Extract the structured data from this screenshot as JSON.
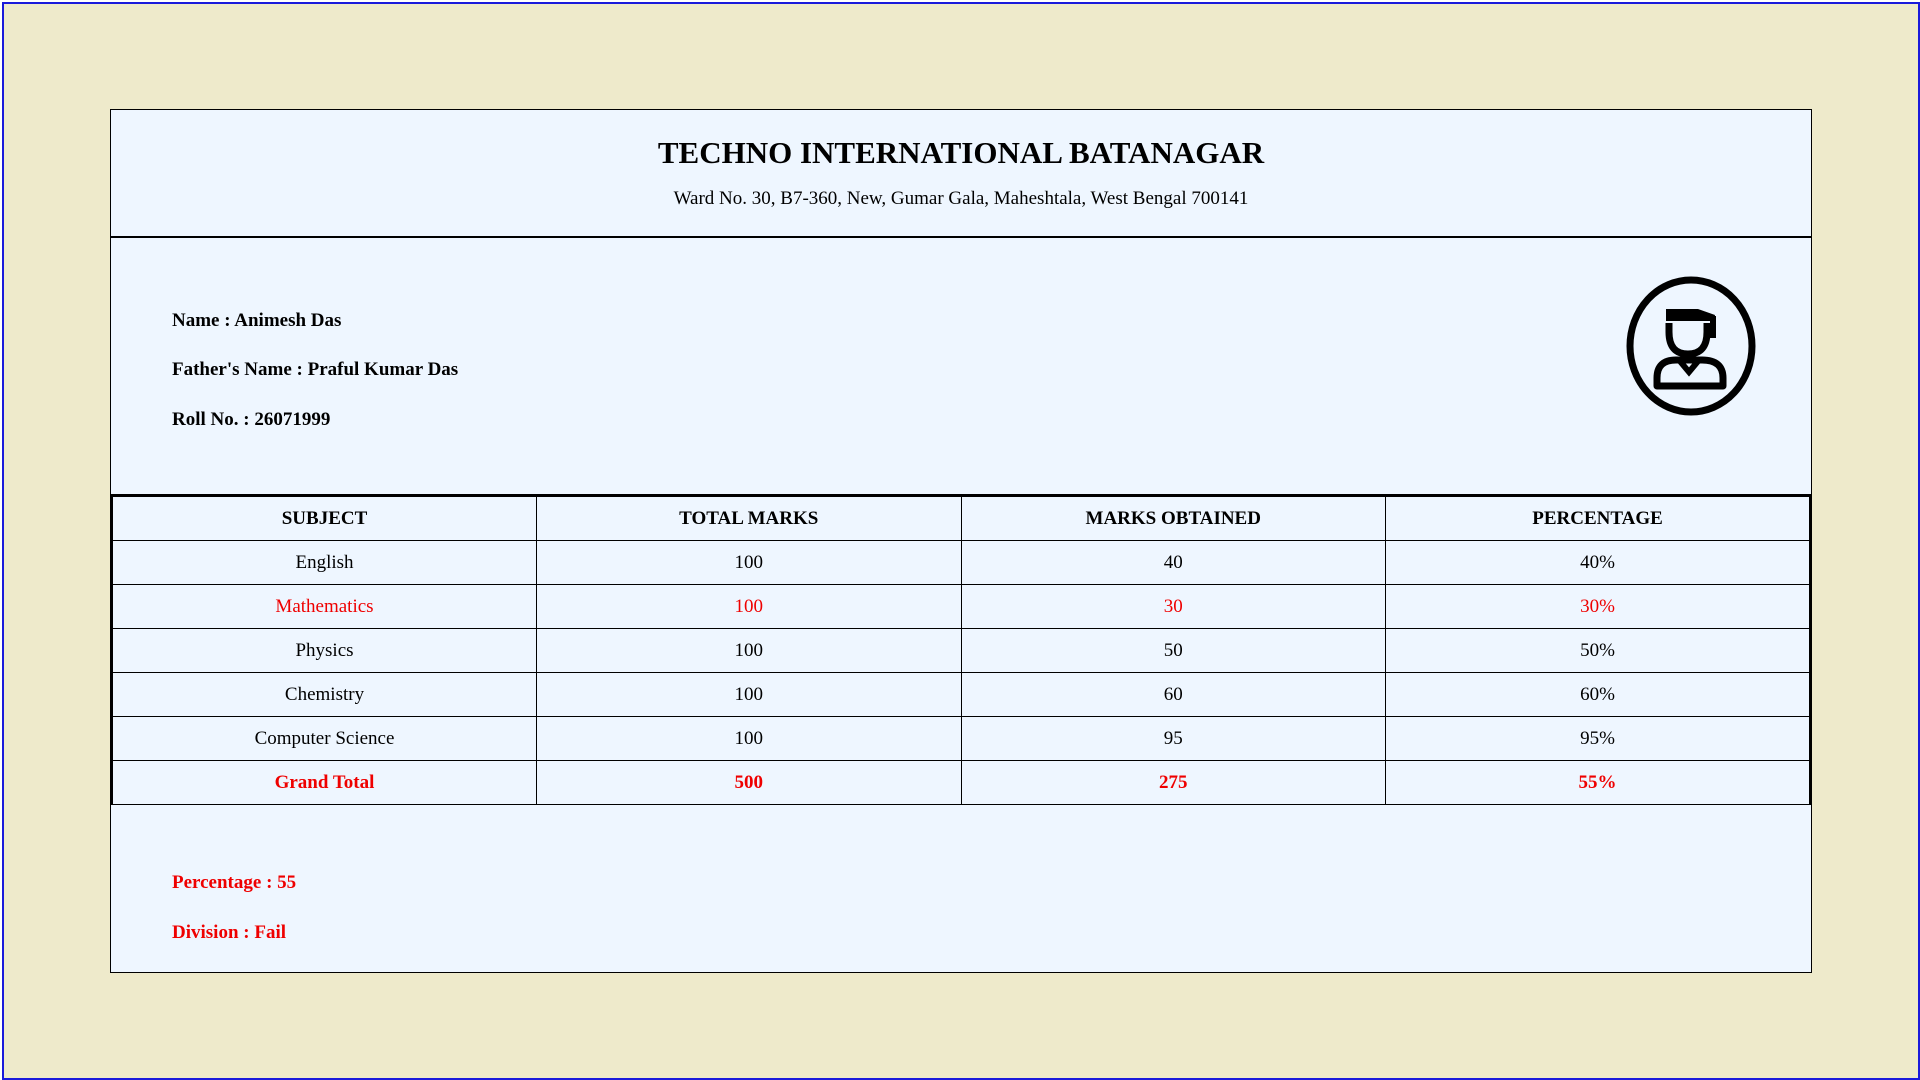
{
  "school": {
    "name": "TECHNO INTERNATIONAL BATANAGAR",
    "address": "Ward No. 30, B7-360, New, Gumar Gala, Maheshtala, West Bengal 700141"
  },
  "student": {
    "name_line": "Name : Animesh Das",
    "father_line": "Father's Name : Praful Kumar Das",
    "roll_line": "Roll No. : 26071999",
    "avatar_icon": "student-graduate-icon"
  },
  "table": {
    "headers": [
      "SUBJECT",
      "TOTAL MARKS",
      "MARKS OBTAINED",
      "PERCENTAGE"
    ],
    "rows": [
      [
        "English",
        "100",
        "40",
        "40%"
      ],
      [
        "Mathematics",
        "100",
        "30",
        "30%"
      ],
      [
        "Physics",
        "100",
        "50",
        "50%"
      ],
      [
        "Chemistry",
        "100",
        "60",
        "60%"
      ],
      [
        "Computer Science",
        "100",
        "95",
        "95%"
      ]
    ],
    "total": [
      "Grand Total",
      "500",
      "275",
      "55%"
    ]
  },
  "result": {
    "percentage_line": "Percentage : 55",
    "division_line": "Division : Fail"
  },
  "colors": {
    "page_background": "#eeeacb",
    "card_background": "#eef6ff",
    "frame_border": "#1a1adb",
    "fail_red": "#ef0000"
  }
}
